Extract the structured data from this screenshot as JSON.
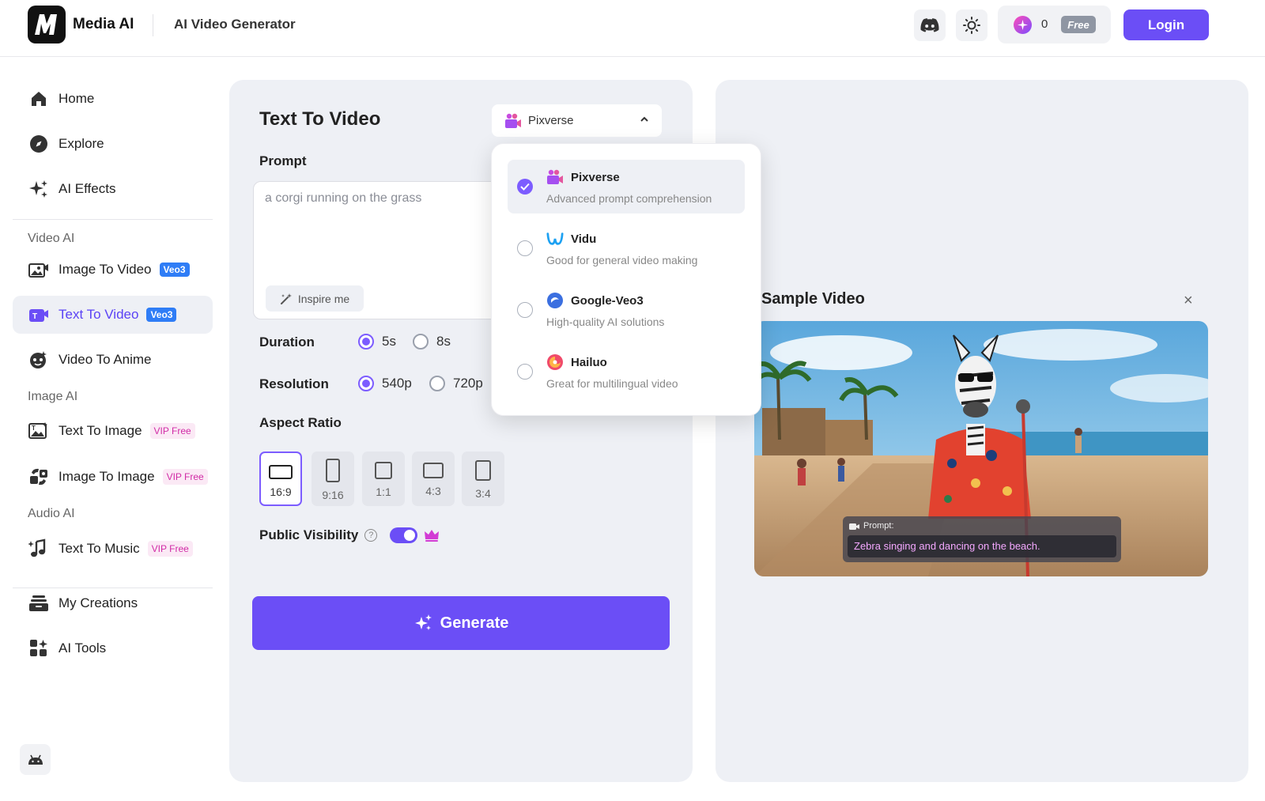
{
  "header": {
    "brand": "Media AI",
    "title": "AI Video Generator",
    "credits_count": "0",
    "free_badge": "Free",
    "login_label": "Login"
  },
  "sidebar": {
    "home": "Home",
    "explore": "Explore",
    "ai_effects": "AI Effects",
    "section_video": "Video AI",
    "image_to_video": "Image To Video",
    "image_to_video_tag": "Veo3",
    "text_to_video": "Text To Video",
    "text_to_video_tag": "Veo3",
    "video_to_anime": "Video To Anime",
    "section_image": "Image AI",
    "text_to_image": "Text To Image",
    "text_to_image_tag": "VIP Free",
    "image_to_image": "Image To Image",
    "image_to_image_tag": "VIP Free",
    "section_audio": "Audio AI",
    "text_to_music": "Text To Music",
    "text_to_music_tag": "VIP Free",
    "my_creations": "My Creations",
    "ai_tools": "AI Tools"
  },
  "form": {
    "title": "Text To Video",
    "model_selected": "Pixverse",
    "prompt_label": "Prompt",
    "prompt_placeholder": "a corgi running on the grass",
    "inspire_label": "Inspire me",
    "duration_label": "Duration",
    "duration_options": [
      "5s",
      "8s"
    ],
    "duration_selected": "5s",
    "resolution_label": "Resolution",
    "resolution_options": [
      "540p",
      "720p"
    ],
    "resolution_selected": "540p",
    "aspect_label": "Aspect Ratio",
    "aspect_options": [
      "16:9",
      "9:16",
      "1:1",
      "4:3",
      "3:4"
    ],
    "aspect_selected": "16:9",
    "visibility_label": "Public Visibility",
    "visibility_help": "?",
    "visibility_on": true,
    "generate_label": "Generate"
  },
  "model_dropdown": {
    "items": [
      {
        "name": "Pixverse",
        "desc": "Advanced prompt comprehension",
        "selected": true
      },
      {
        "name": "Vidu",
        "desc": "Good for general video making",
        "selected": false
      },
      {
        "name": "Google-Veo3",
        "desc": "High-quality AI solutions",
        "selected": false
      },
      {
        "name": "Hailuo",
        "desc": "Great for multilingual video",
        "selected": false
      }
    ]
  },
  "sample": {
    "title": "Sample Video",
    "close_icon": "×",
    "prompt_heading": "Prompt:",
    "prompt_text": "Zebra singing and dancing on the beach."
  },
  "colors": {
    "accent": "#6b4ef6",
    "panel_bg": "#eef0f5",
    "veo_tag": "#2f7df6",
    "vip_tag_text": "#d12ba6"
  }
}
